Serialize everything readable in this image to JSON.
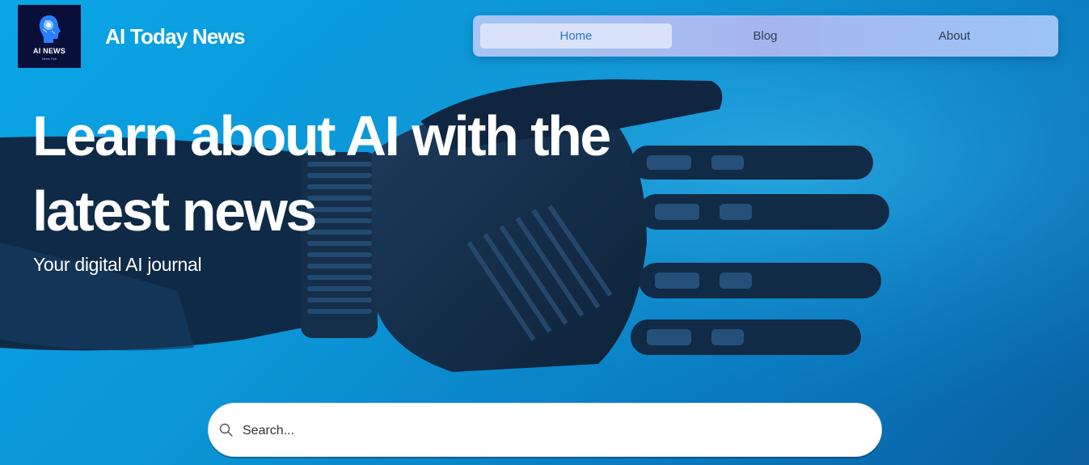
{
  "logo": {
    "text": "AI NEWS",
    "sub": "News Hub"
  },
  "header": {
    "site_title": "AI Today News"
  },
  "nav": {
    "items": [
      {
        "label": "Home",
        "active": true
      },
      {
        "label": "Blog",
        "active": false
      },
      {
        "label": "About",
        "active": false
      }
    ]
  },
  "hero": {
    "title": "Learn about AI with the latest news",
    "subtitle": "Your digital AI journal"
  },
  "search": {
    "placeholder": "Search..."
  },
  "colors": {
    "background": "#0b95d6",
    "nav_active_bg": "#d9e2f8",
    "nav_active_text": "#2f6fd6",
    "logo_bg": "#0a0f3a"
  },
  "icons": {
    "logo": "ai-head-icon",
    "search": "search-icon"
  }
}
